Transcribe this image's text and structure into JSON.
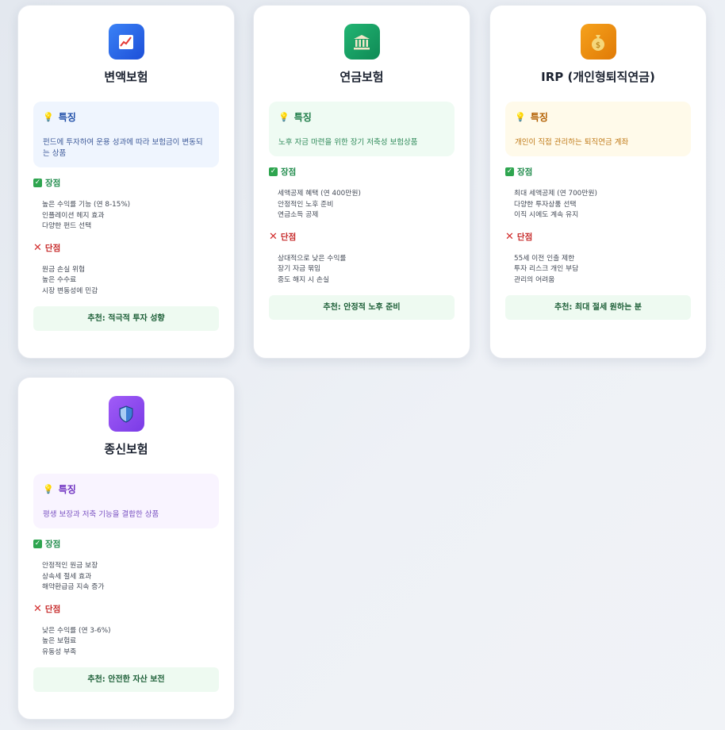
{
  "labels": {
    "feature": "특징",
    "pros": "장점",
    "cons": "단점"
  },
  "cards": [
    {
      "icon": "chart-up-icon",
      "accent": "#2b6ff0",
      "title": "변액보험",
      "feature": "펀드에 투자하여 운용 성과에 따라 보험금이 변동되는 상품",
      "pros": [
        "높은 수익률 기능 (연 8-15%)",
        "인플레이션 헤지 효과",
        "다양한 펀드 선택"
      ],
      "cons": [
        "원금 손실 위험",
        "높은 수수료",
        "시장 변동성에 민감"
      ],
      "recommend": "추천: 적극적 투자 성향"
    },
    {
      "icon": "bank-icon",
      "accent": "#18a566",
      "title": "연금보험",
      "feature": "노후 자금 마련을 위한 장기 저축성 보험상품",
      "pros": [
        "세액공제 혜택 (연 400만원)",
        "안정적인 노후 준비",
        "연금소득 공제"
      ],
      "cons": [
        "상대적으로 낮은 수익률",
        "장기 자금 묶임",
        "중도 해지 시 손실"
      ],
      "recommend": "추천: 안정적 노후 준비"
    },
    {
      "icon": "money-bag-icon",
      "accent": "#f08d12",
      "title": "IRP (개인형퇴직연금)",
      "feature": "개인이 직접 관리하는 퇴직연금 계좌",
      "pros": [
        "최대 세액공제 (연 700만원)",
        "다양한 투자상품 선택",
        "이직 시에도 계속 유지"
      ],
      "cons": [
        "55세 이전 인출 제한",
        "투자 리스크 개인 부담",
        "관리의 어려움"
      ],
      "recommend": "추천: 최대 절세 원하는 분"
    },
    {
      "icon": "shield-icon",
      "accent": "#8a4cf0",
      "title": "종신보험",
      "feature": "평생 보장과 저축 기능을 결합한 상품",
      "pros": [
        "안정적인 원금 보장",
        "상속세 절세 효과",
        "해약환급금 지속 증가"
      ],
      "cons": [
        "낮은 수익률 (연 3-6%)",
        "높은 보험료",
        "유동성 부족"
      ],
      "recommend": "추천: 안전한 자산 보전"
    }
  ]
}
